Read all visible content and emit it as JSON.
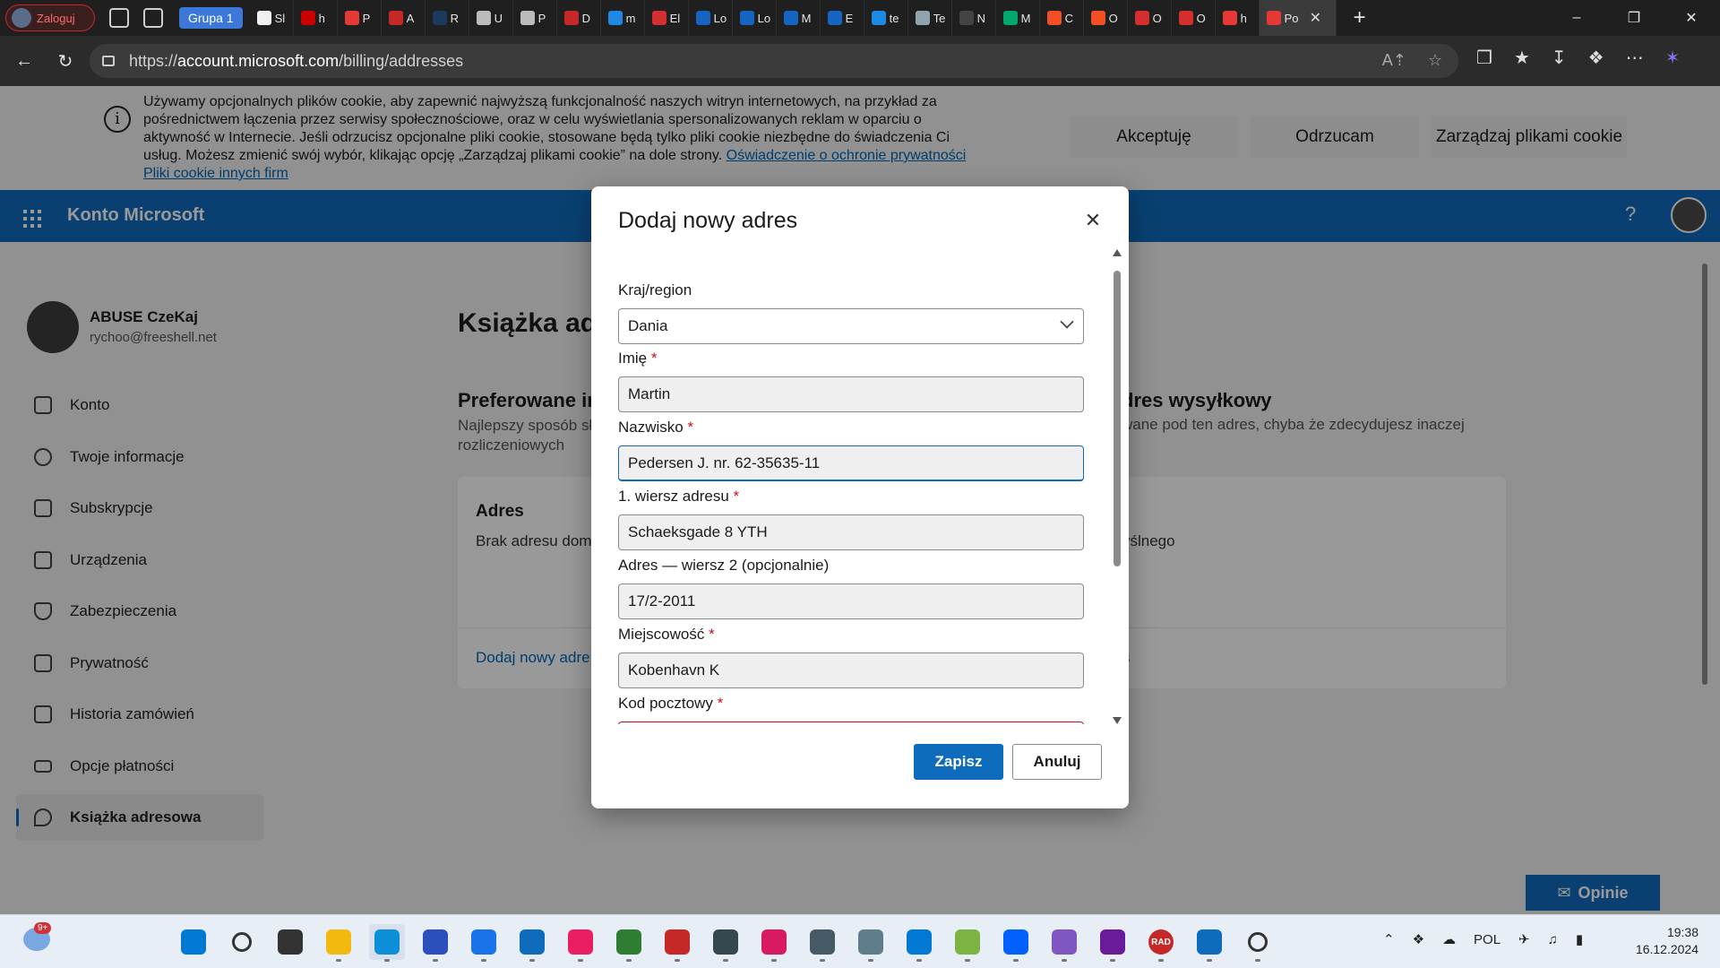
{
  "browser": {
    "profile_label": "Zaloguj",
    "group_label": "Grupa 1",
    "tabs": [
      {
        "title": "Sl",
        "color": "#f0f0f0"
      },
      {
        "title": "h",
        "color": "#cc0000"
      },
      {
        "title": "P",
        "color": "#e53935"
      },
      {
        "title": "A",
        "color": "#c62828"
      },
      {
        "title": "R",
        "color": "#1b3a5c"
      },
      {
        "title": "U",
        "color": "#bbbbbb"
      },
      {
        "title": "P",
        "color": "#bbbbbb"
      },
      {
        "title": "D",
        "color": "#c62828"
      },
      {
        "title": "m",
        "color": "#1e88e5"
      },
      {
        "title": "El",
        "color": "#d32f2f"
      },
      {
        "title": "Lo",
        "color": "#1565c0"
      },
      {
        "title": "Lo",
        "color": "#1565c0"
      },
      {
        "title": "M",
        "color": "#1565c0"
      },
      {
        "title": "E",
        "color": "#1565c0"
      },
      {
        "title": "te",
        "color": "#1e88e5"
      },
      {
        "title": "Te",
        "color": "#90a4ae"
      },
      {
        "title": "N",
        "color": "#444444"
      },
      {
        "title": "M",
        "color": "#00a86b"
      },
      {
        "title": "C",
        "color": "#f25022"
      },
      {
        "title": "O",
        "color": "#f25022"
      },
      {
        "title": "O",
        "color": "#d32f2f"
      },
      {
        "title": "O",
        "color": "#d32f2f"
      },
      {
        "title": "h",
        "color": "#e53935"
      }
    ],
    "active_tab": {
      "title": "Po",
      "color": "#e53935"
    },
    "url_prefix": "https://",
    "url_host": "account.microsoft.com",
    "url_path": "/billing/addresses"
  },
  "cookie_banner": {
    "text": "Używamy opcjonalnych plików cookie, aby zapewnić najwyższą funkcjonalność naszych witryn internetowych, na przykład za pośrednictwem łączenia przez serwisy społecznościowe, oraz w celu wyświetlania spersonalizowanych reklam w oparciu o aktywność w Internecie. Jeśli odrzucisz opcjonalne pliki cookie, stosowane będą tylko pliki cookie niezbędne do świadczenia Ci usług. Możesz zmienić swój wybór, klikając opcję „Zarządzaj plikami cookie” na dole strony. ",
    "privacy_link": "Oświadczenie o ochronie prywatności",
    "third_party_link": "Pliki cookie innych firm",
    "accept": "Akceptuję",
    "reject": "Odrzucam",
    "manage": "Zarządzaj plikami cookie"
  },
  "header": {
    "title": "Konto Microsoft",
    "help": "?"
  },
  "user": {
    "name": "ABUSE CzeKaj",
    "email": "rychoo@freeshell.net"
  },
  "sidebar": {
    "items": [
      {
        "label": "Konto"
      },
      {
        "label": "Twoje informacje"
      },
      {
        "label": "Subskrypcje"
      },
      {
        "label": "Urządzenia"
      },
      {
        "label": "Zabezpieczenia"
      },
      {
        "label": "Prywatność"
      },
      {
        "label": "Historia zamówień"
      },
      {
        "label": "Opcje płatności"
      },
      {
        "label": "Książka adresowa"
      }
    ]
  },
  "main": {
    "title": "Książka adr",
    "left_section_title": "Preferowane ir",
    "left_section_desc": "Najlepszy sposób sł rozliczeniowych",
    "right_section_title": "dres wysyłkowy",
    "right_section_desc": "wane pod ten adres, chyba że zdecydujesz inaczej",
    "card_header": "Adres",
    "card_text": "Brak adresu dom",
    "card_text_right": "yślnego",
    "card_link": "Dodaj nowy adre",
    "card_link_right": "s",
    "feedback": "Opinie"
  },
  "dialog": {
    "title": "Dodaj nowy adres",
    "fields": {
      "country": {
        "label": "Kraj/region",
        "value": "Dania"
      },
      "first_name": {
        "label": "Imię",
        "required": "*",
        "value": "Martin"
      },
      "last_name": {
        "label": "Nazwisko",
        "required": "*",
        "value": "Pedersen J. nr. 62-35635-11"
      },
      "address1": {
        "label": "1. wiersz adresu",
        "required": "*",
        "value": "Schaeksgade 8 YTH"
      },
      "address2": {
        "label": "Adres — wiersz 2 (opcjonalnie)",
        "value": "17/2-2011"
      },
      "city": {
        "label": "Miejscowość",
        "required": "*",
        "value": "Kobenhavn K"
      },
      "postal": {
        "label": "Kod pocztowy",
        "required": "*",
        "value": ""
      }
    },
    "save": "Zapisz",
    "cancel": "Anuluj"
  },
  "taskbar": {
    "weather_badge": "9+",
    "apps": [
      {
        "name": "start",
        "color": "#0078d4"
      },
      {
        "name": "search",
        "color": "#333333"
      },
      {
        "name": "task-view",
        "color": "#333333"
      },
      {
        "name": "file-explorer",
        "color": "#f2b90f"
      },
      {
        "name": "edge",
        "color": "#0c8ed9"
      },
      {
        "name": "save-app",
        "color": "#2b4fbd"
      },
      {
        "name": "store",
        "color": "#1a73e8"
      },
      {
        "name": "outlook",
        "color": "#0f6cbd"
      },
      {
        "name": "pinwheel",
        "color": "#e91e63"
      },
      {
        "name": "globe",
        "color": "#2e7d32"
      },
      {
        "name": "red-app",
        "color": "#c62828"
      },
      {
        "name": "box-app",
        "color": "#37474f"
      },
      {
        "name": "paint-app",
        "color": "#d81b60"
      },
      {
        "name": "network-app",
        "color": "#455a64"
      },
      {
        "name": "settings-app",
        "color": "#607d8b"
      },
      {
        "name": "vscode",
        "color": "#0078d4"
      },
      {
        "name": "builder-app",
        "color": "#7cb342"
      },
      {
        "name": "dropbox",
        "color": "#0061ff"
      },
      {
        "name": "tor",
        "color": "#7e57c2"
      },
      {
        "name": "github",
        "color": "#6a1b9a"
      },
      {
        "name": "rad",
        "color": "#c62828"
      },
      {
        "name": "defender",
        "color": "#0f6cbd"
      },
      {
        "name": "more",
        "color": "#333333"
      }
    ],
    "rad_label": "RAD",
    "lang": "POL",
    "time": "19:38",
    "date": "16.12.2024"
  }
}
